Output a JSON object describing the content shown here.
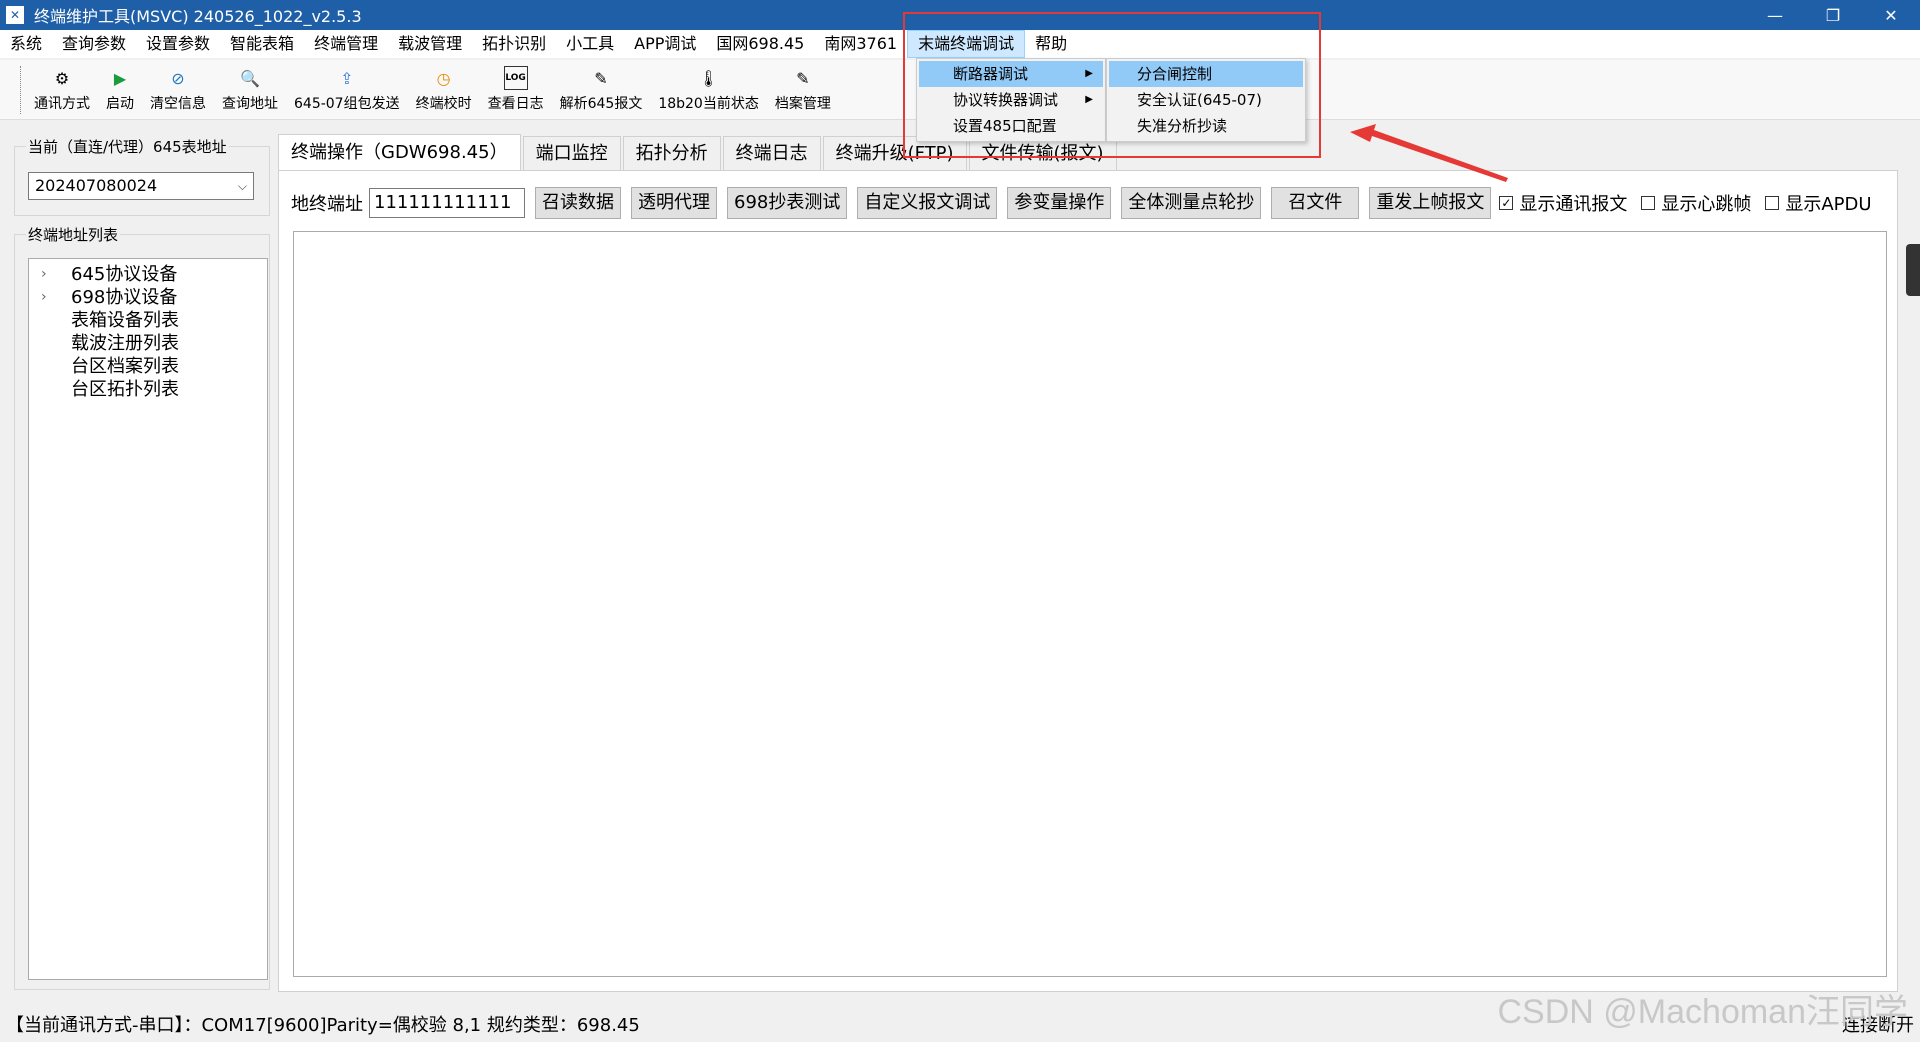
{
  "window": {
    "title": "终端维护工具(MSVC) 240526_1022_v2.5.3",
    "app_icon": "✕"
  },
  "menubar": {
    "items": [
      "系统",
      "查询参数",
      "设置参数",
      "智能表箱",
      "终端管理",
      "载波管理",
      "拓扑识别",
      "小工具",
      "APP调试",
      "国网698.45",
      "南网3761",
      "末端终端调试",
      "帮助"
    ],
    "active_index": 11
  },
  "toolbar": {
    "buttons": [
      {
        "label": "通讯方式",
        "icon": "⚙"
      },
      {
        "label": "启动",
        "icon": "▶"
      },
      {
        "label": "清空信息",
        "icon": "⊘"
      },
      {
        "label": "查询地址",
        "icon": "🔍"
      },
      {
        "label": "645-07组包发送",
        "icon": "⇪"
      },
      {
        "label": "终端校时",
        "icon": "◷"
      },
      {
        "label": "查看日志",
        "icon": "LOG"
      },
      {
        "label": "解析645报文",
        "icon": "✎"
      },
      {
        "label": "18b20当前状态",
        "icon": "🌡"
      },
      {
        "label": "档案管理",
        "icon": "✎"
      }
    ]
  },
  "left_panel": {
    "group1_title": "当前（直连/代理）645表地址",
    "address_value": "202407080024",
    "group2_title": "终端地址列表",
    "tree": [
      {
        "label": "645协议设备",
        "expandable": true
      },
      {
        "label": "698协议设备",
        "expandable": true
      },
      {
        "label": "表箱设备列表",
        "expandable": false
      },
      {
        "label": "载波注册列表",
        "expandable": false
      },
      {
        "label": "台区档案列表",
        "expandable": false
      },
      {
        "label": "台区拓扑列表",
        "expandable": false
      }
    ]
  },
  "tabs": [
    "终端操作（GDW698.45）",
    "端口监控",
    "拓扑分析",
    "终端日志",
    "终端升级(FTP)",
    "文件传输(报文)"
  ],
  "controls": {
    "addr_label": "地终端址",
    "addr_value": "111111111111",
    "buttons": [
      "召读数据",
      "透明代理",
      "698抄表测试",
      "自定义报文调试",
      "参变量操作",
      "全体测量点轮抄",
      "召文件",
      "重发上帧报文"
    ],
    "checkboxes": [
      {
        "label": "显示通讯报文",
        "checked": true
      },
      {
        "label": "显示心跳帧",
        "checked": false
      },
      {
        "label": "显示APDU",
        "checked": false
      }
    ]
  },
  "dropdown": {
    "items": [
      {
        "label": "断路器调试",
        "has_sub": true,
        "highlighted": true
      },
      {
        "label": "协议转换器调试",
        "has_sub": true,
        "highlighted": false
      },
      {
        "label": "设置485口配置",
        "has_sub": false,
        "highlighted": false
      }
    ],
    "submenu": [
      {
        "label": "分合闸控制",
        "highlighted": true
      },
      {
        "label": "安全认证(645-07)",
        "highlighted": false
      },
      {
        "label": "失准分析抄读",
        "highlighted": false
      }
    ]
  },
  "status": {
    "left": "【当前通讯方式-串口】：COM17[9600]Parity=偶校验 8,1 规约类型：698.45",
    "right": "连接断开"
  },
  "watermark": "CSDN @Machoman汪同学",
  "colors": {
    "titlebar": "#1f5fa8",
    "menu_highlight": "#91c9f7",
    "annotation": "#e53935"
  }
}
